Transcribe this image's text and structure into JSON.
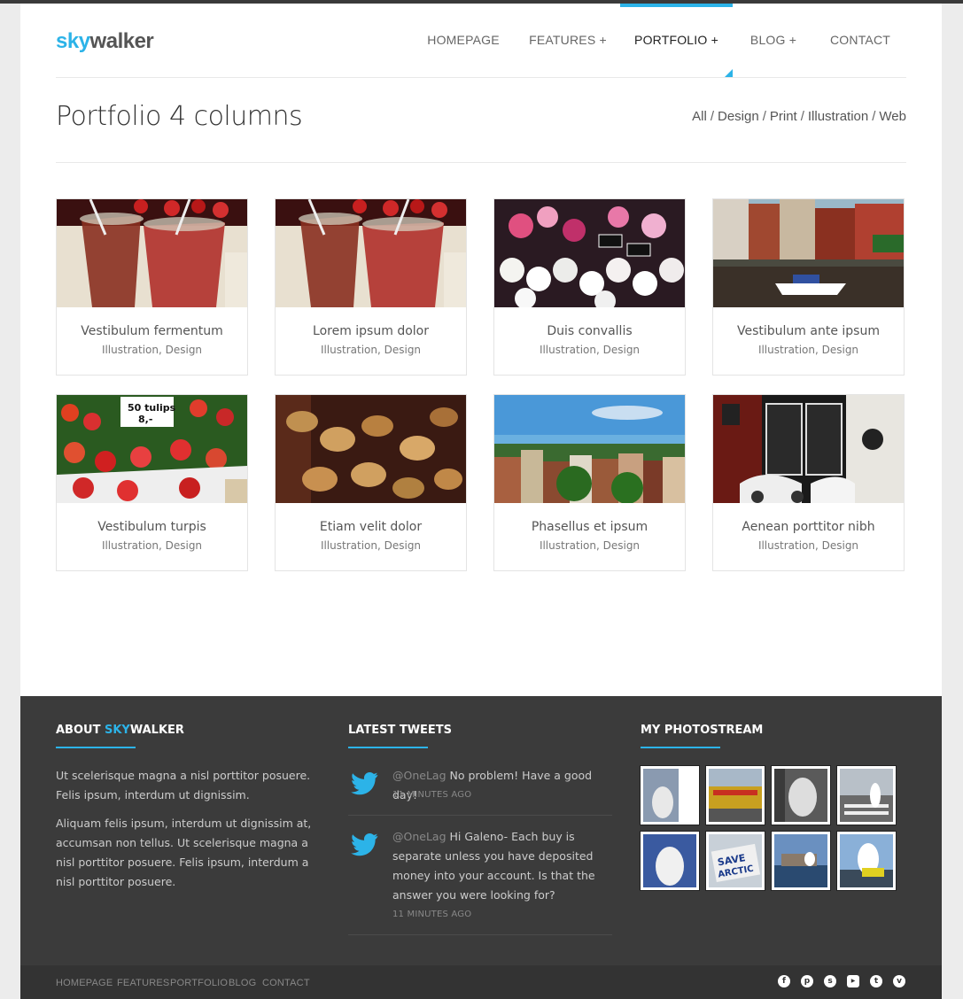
{
  "logo": {
    "sky": "sky",
    "walker": "walker"
  },
  "nav": [
    {
      "label": "HOMEPAGE"
    },
    {
      "label": "FEATURES +"
    },
    {
      "label": "PORTFOLIO +"
    },
    {
      "label": "BLOG +"
    },
    {
      "label": "CONTACT"
    }
  ],
  "corner_button": "+",
  "page_title": "Portfolio 4 columns",
  "filters": [
    "All",
    "Design",
    "Print",
    "Illustration",
    "Web"
  ],
  "portfolio": [
    {
      "title": "Vestibulum fermentum",
      "cats": "Illustration, Design",
      "image": "strawberry-drinks"
    },
    {
      "title": "Lorem ipsum dolor",
      "cats": "Illustration, Design",
      "image": "strawberry-drinks"
    },
    {
      "title": "Duis convallis",
      "cats": "Illustration, Design",
      "image": "flower-market"
    },
    {
      "title": "Vestibulum ante ipsum",
      "cats": "Illustration, Design",
      "image": "canal-boat"
    },
    {
      "title": "Vestibulum turpis",
      "cats": "Illustration, Design",
      "image": "tulips"
    },
    {
      "title": "Etiam velit dolor",
      "cats": "Illustration, Design",
      "image": "tea-tins"
    },
    {
      "title": "Phasellus et ipsum",
      "cats": "Illustration, Design",
      "image": "city-rooftops"
    },
    {
      "title": "Aenean porttitor nibh",
      "cats": "Illustration, Design",
      "image": "shop-scooters"
    }
  ],
  "footer": {
    "about": {
      "title_prefix": "ABOUT ",
      "title_blue": "SKY",
      "title_suffix": "WALKER",
      "p1": "Ut scelerisque magna a nisl porttitor posuere. Felis ipsum, interdum ut dignissim.",
      "p2": "Aliquam felis ipsum, interdum ut dignissim at, accumsan non tellus. Ut scelerisque magna a nisl porttitor posuere. Felis ipsum, interdum a nisl porttitor posuere."
    },
    "tweets": {
      "title": "LATEST TWEETS",
      "items": [
        {
          "handle": "@OneLag",
          "text": " No problem! Have a good day!",
          "time": "11 MINUTES AGO"
        },
        {
          "handle": "@OneLag",
          "text": " Hi Galeno- Each buy is separate unless you have deposited money into your account. Is that the answer you were looking for?",
          "time": "11 MINUTES AGO"
        }
      ]
    },
    "photostream": {
      "title": "MY PHOTOSTREAM",
      "count": 8
    }
  },
  "bottom_links": [
    "HOMEPAGE",
    "FEATURES",
    "PORTFOLIO",
    "BLOG",
    "CONTACT"
  ],
  "social": [
    "facebook-icon",
    "pinterest-icon",
    "skype-icon",
    "youtube-icon",
    "twitter-icon",
    "vimeo-icon"
  ],
  "colors": {
    "accent": "#2cb3e8",
    "footer": "#3b3b3b",
    "bottombar": "#333333"
  }
}
